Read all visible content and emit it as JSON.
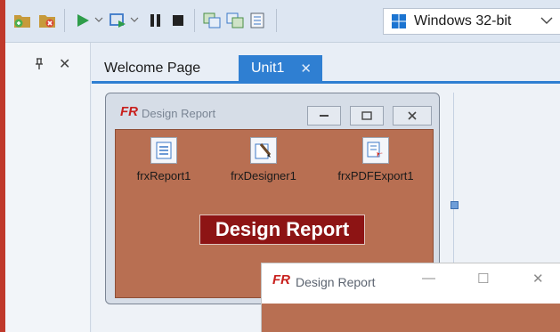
{
  "toolbar": {
    "platform_label": "Windows 32-bit",
    "buttons": [
      "new-project-icon",
      "close-project-icon",
      "run-icon",
      "run-dropdown-icon",
      "step-icon",
      "step-dropdown-icon",
      "pause-icon",
      "stop-icon",
      "view-form-icon",
      "view-unit-icon",
      "toggle-form-unit-icon"
    ]
  },
  "panel": {
    "pin_glyph": "⌐",
    "close_glyph": "✕"
  },
  "tabs": [
    {
      "label": "Welcome Page",
      "active": false
    },
    {
      "label": "Unit1",
      "active": true,
      "close_glyph": "✕"
    }
  ],
  "form_design": {
    "logo_text": "FR",
    "title": "Design Report",
    "components": [
      {
        "label": "frxReport1",
        "icon": "report-icon"
      },
      {
        "label": "frxDesigner1",
        "icon": "designer-icon"
      },
      {
        "label": "frxPDFExport1",
        "icon": "pdf-export-icon"
      }
    ],
    "button_label": "Design Report"
  },
  "form_runtime": {
    "logo_text": "FR",
    "title": "Design Report",
    "minimize_glyph": "—",
    "maximize_glyph": "☐",
    "close_glyph": "✕"
  },
  "colors": {
    "accent": "#2f7fd2",
    "form_client": "#b86f52",
    "button_bg": "#8d1414",
    "frame_border": "#c0392b"
  }
}
